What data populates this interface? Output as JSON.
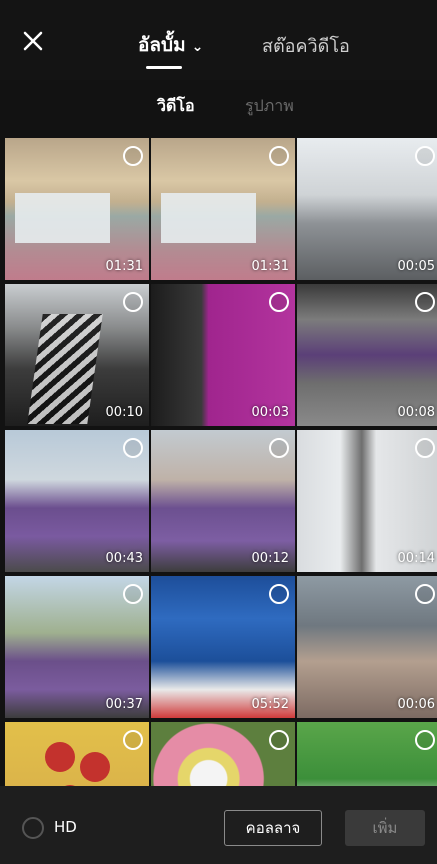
{
  "header": {
    "close_icon": "close-icon",
    "album_tab": "อัลบั้ม",
    "album_chevron": "⌄",
    "stock_tab": "สต๊อควิดีโอ"
  },
  "filters": {
    "video": "วิดีโอ",
    "photo": "รูปภาพ"
  },
  "grid": {
    "items": [
      {
        "duration": "01:31",
        "thumb": "classroom"
      },
      {
        "duration": "01:31",
        "thumb": "classroom"
      },
      {
        "duration": "00:05",
        "thumb": "station"
      },
      {
        "duration": "00:10",
        "thumb": "walkway"
      },
      {
        "duration": "00:03",
        "thumb": "civic-center"
      },
      {
        "duration": "00:08",
        "thumb": "platform"
      },
      {
        "duration": "00:43",
        "thumb": "train-interior"
      },
      {
        "duration": "00:12",
        "thumb": "train-interior"
      },
      {
        "duration": "00:14",
        "thumb": "train-door"
      },
      {
        "duration": "00:37",
        "thumb": "train-interior"
      },
      {
        "duration": "05:52",
        "thumb": "news"
      },
      {
        "duration": "00:06",
        "thumb": "crowd"
      },
      {
        "duration": "",
        "thumb": "art"
      },
      {
        "duration": "",
        "thumb": "flowers"
      },
      {
        "duration": "",
        "thumb": "drink"
      }
    ]
  },
  "footer": {
    "hd_label": "HD",
    "collage_label": "คอลลาจ",
    "add_label": "เพิ่ม"
  },
  "colors": {
    "background": "#121212",
    "footer": "#1e1e1e",
    "add_button_disabled": "#3a3a3a"
  }
}
